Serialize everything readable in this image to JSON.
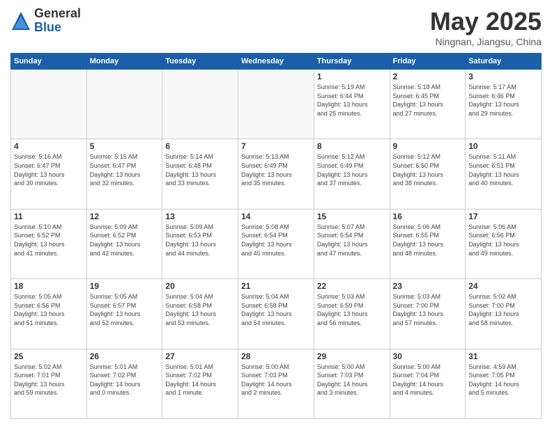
{
  "logo": {
    "general": "General",
    "blue": "Blue"
  },
  "title": "May 2025",
  "location": "Ningnan, Jiangsu, China",
  "days_of_week": [
    "Sunday",
    "Monday",
    "Tuesday",
    "Wednesday",
    "Thursday",
    "Friday",
    "Saturday"
  ],
  "weeks": [
    [
      {
        "day": "",
        "info": ""
      },
      {
        "day": "",
        "info": ""
      },
      {
        "day": "",
        "info": ""
      },
      {
        "day": "",
        "info": ""
      },
      {
        "day": "1",
        "info": "Sunrise: 5:19 AM\nSunset: 6:44 PM\nDaylight: 13 hours\nand 25 minutes."
      },
      {
        "day": "2",
        "info": "Sunrise: 5:18 AM\nSunset: 6:45 PM\nDaylight: 13 hours\nand 27 minutes."
      },
      {
        "day": "3",
        "info": "Sunrise: 5:17 AM\nSunset: 6:46 PM\nDaylight: 13 hours\nand 29 minutes."
      }
    ],
    [
      {
        "day": "4",
        "info": "Sunrise: 5:16 AM\nSunset: 6:47 PM\nDaylight: 13 hours\nand 30 minutes."
      },
      {
        "day": "5",
        "info": "Sunrise: 5:15 AM\nSunset: 6:47 PM\nDaylight: 13 hours\nand 32 minutes."
      },
      {
        "day": "6",
        "info": "Sunrise: 5:14 AM\nSunset: 6:48 PM\nDaylight: 13 hours\nand 33 minutes."
      },
      {
        "day": "7",
        "info": "Sunrise: 5:13 AM\nSunset: 6:49 PM\nDaylight: 13 hours\nand 35 minutes."
      },
      {
        "day": "8",
        "info": "Sunrise: 5:12 AM\nSunset: 6:49 PM\nDaylight: 13 hours\nand 37 minutes."
      },
      {
        "day": "9",
        "info": "Sunrise: 5:12 AM\nSunset: 6:50 PM\nDaylight: 13 hours\nand 38 minutes."
      },
      {
        "day": "10",
        "info": "Sunrise: 5:11 AM\nSunset: 6:51 PM\nDaylight: 13 hours\nand 40 minutes."
      }
    ],
    [
      {
        "day": "11",
        "info": "Sunrise: 5:10 AM\nSunset: 6:52 PM\nDaylight: 13 hours\nand 41 minutes."
      },
      {
        "day": "12",
        "info": "Sunrise: 5:09 AM\nSunset: 6:52 PM\nDaylight: 13 hours\nand 42 minutes."
      },
      {
        "day": "13",
        "info": "Sunrise: 5:09 AM\nSunset: 6:53 PM\nDaylight: 13 hours\nand 44 minutes."
      },
      {
        "day": "14",
        "info": "Sunrise: 5:08 AM\nSunset: 6:54 PM\nDaylight: 13 hours\nand 45 minutes."
      },
      {
        "day": "15",
        "info": "Sunrise: 5:07 AM\nSunset: 6:54 PM\nDaylight: 13 hours\nand 47 minutes."
      },
      {
        "day": "16",
        "info": "Sunrise: 5:06 AM\nSunset: 6:55 PM\nDaylight: 13 hours\nand 48 minutes."
      },
      {
        "day": "17",
        "info": "Sunrise: 5:06 AM\nSunset: 6:56 PM\nDaylight: 13 hours\nand 49 minutes."
      }
    ],
    [
      {
        "day": "18",
        "info": "Sunrise: 5:05 AM\nSunset: 6:56 PM\nDaylight: 13 hours\nand 51 minutes."
      },
      {
        "day": "19",
        "info": "Sunrise: 5:05 AM\nSunset: 6:57 PM\nDaylight: 13 hours\nand 52 minutes."
      },
      {
        "day": "20",
        "info": "Sunrise: 5:04 AM\nSunset: 6:58 PM\nDaylight: 13 hours\nand 53 minutes."
      },
      {
        "day": "21",
        "info": "Sunrise: 5:04 AM\nSunset: 6:58 PM\nDaylight: 13 hours\nand 54 minutes."
      },
      {
        "day": "22",
        "info": "Sunrise: 5:03 AM\nSunset: 6:59 PM\nDaylight: 13 hours\nand 56 minutes."
      },
      {
        "day": "23",
        "info": "Sunrise: 5:03 AM\nSunset: 7:00 PM\nDaylight: 13 hours\nand 57 minutes."
      },
      {
        "day": "24",
        "info": "Sunrise: 5:02 AM\nSunset: 7:00 PM\nDaylight: 13 hours\nand 58 minutes."
      }
    ],
    [
      {
        "day": "25",
        "info": "Sunrise: 5:02 AM\nSunset: 7:01 PM\nDaylight: 13 hours\nand 59 minutes."
      },
      {
        "day": "26",
        "info": "Sunrise: 5:01 AM\nSunset: 7:02 PM\nDaylight: 14 hours\nand 0 minutes."
      },
      {
        "day": "27",
        "info": "Sunrise: 5:01 AM\nSunset: 7:02 PM\nDaylight: 14 hours\nand 1 minute."
      },
      {
        "day": "28",
        "info": "Sunrise: 5:00 AM\nSunset: 7:03 PM\nDaylight: 14 hours\nand 2 minutes."
      },
      {
        "day": "29",
        "info": "Sunrise: 5:00 AM\nSunset: 7:03 PM\nDaylight: 14 hours\nand 3 minutes."
      },
      {
        "day": "30",
        "info": "Sunrise: 5:00 AM\nSunset: 7:04 PM\nDaylight: 14 hours\nand 4 minutes."
      },
      {
        "day": "31",
        "info": "Sunrise: 4:59 AM\nSunset: 7:05 PM\nDaylight: 14 hours\nand 5 minutes."
      }
    ]
  ]
}
